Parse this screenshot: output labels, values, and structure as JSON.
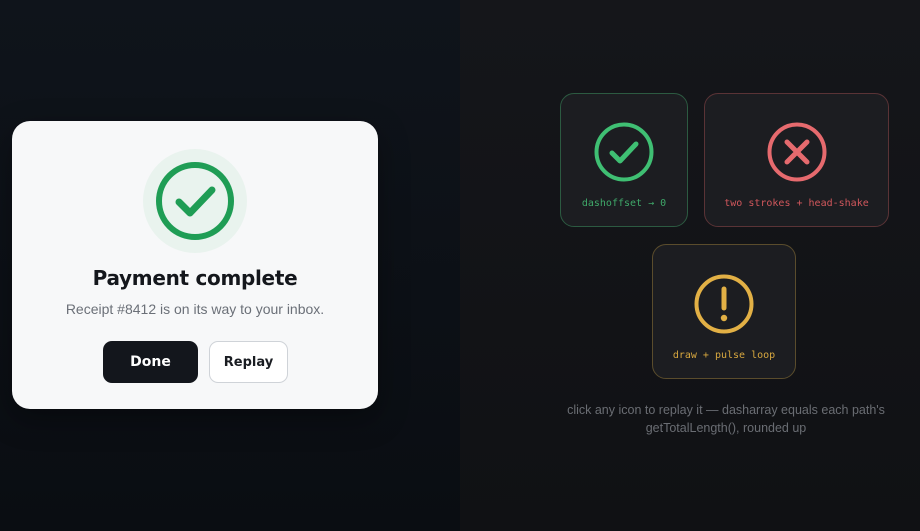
{
  "modal": {
    "icon": "check-circle-icon",
    "title": "Payment complete",
    "subtitle": "Receipt #8412 is on its way to your inbox.",
    "done_label": "Done",
    "replay_label": "Replay"
  },
  "tiles": [
    {
      "icon": "check-circle-icon",
      "caption": "dashoffset → 0",
      "color": "#3fbf73"
    },
    {
      "icon": "x-circle-icon",
      "caption": "two strokes + head-shake",
      "color": "#e66a6e"
    },
    {
      "icon": "exclamation-circle-icon",
      "caption": "draw + pulse loop",
      "color": "#e2b045"
    }
  ],
  "hint": {
    "line1": "click any icon to replay it — dasharray equals each path's",
    "line2": "getTotalLength(), rounded up"
  },
  "colors": {
    "success_modal": "#1f9d55",
    "background": "#0c1016",
    "panel": "#f7f8f9"
  }
}
